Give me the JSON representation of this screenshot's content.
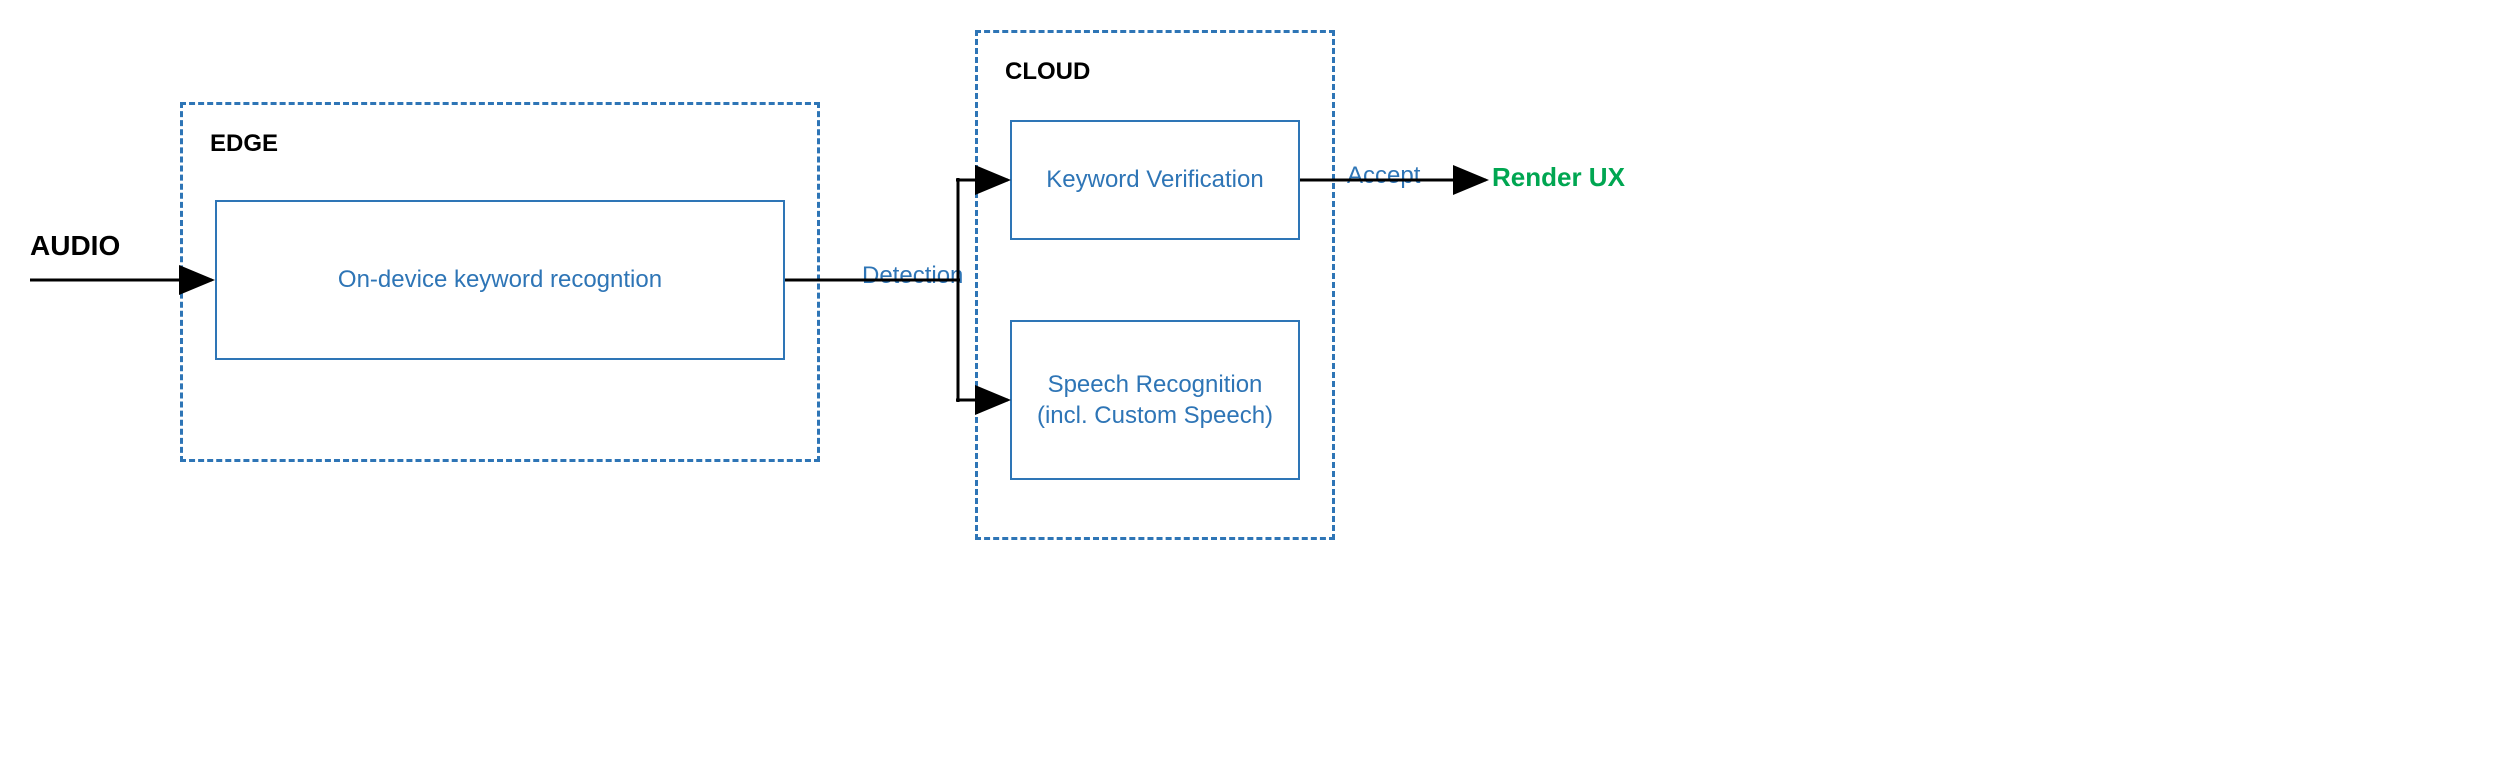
{
  "labels": {
    "audio": "AUDIO",
    "edge": "EDGE",
    "cloud": "CLOUD",
    "detection": "Detection",
    "accept": "Accept",
    "render": "Render UX"
  },
  "boxes": {
    "on_device": "On-device keyword recogntion",
    "keyword_verification": "Keyword Verification",
    "speech_recognition": "Speech Recognition\n(incl. Custom Speech)"
  }
}
